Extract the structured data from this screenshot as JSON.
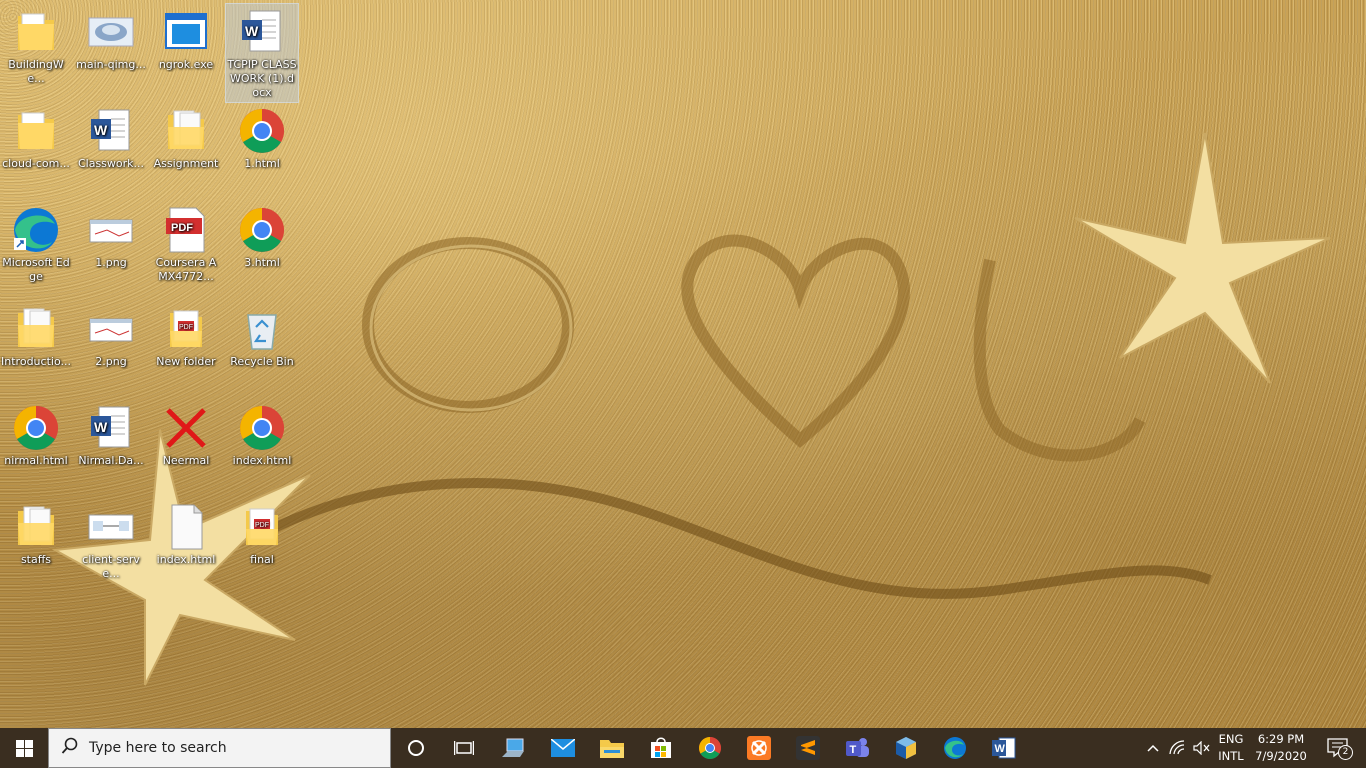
{
  "desktop": {
    "icons": [
      {
        "label": "BuildingWe...",
        "type": "folder"
      },
      {
        "label": "main-qimg...",
        "type": "image"
      },
      {
        "label": "ngrok.exe",
        "type": "exe"
      },
      {
        "label": "TCPIP CLASSWORK (1).docx",
        "type": "word",
        "selected": true
      },
      {
        "label": "cloud-com...",
        "type": "folder"
      },
      {
        "label": "Classwork...",
        "type": "word"
      },
      {
        "label": "Assignment",
        "type": "folder-docs"
      },
      {
        "label": "1.html",
        "type": "chrome"
      },
      {
        "label": "Microsoft Edge",
        "type": "edge"
      },
      {
        "label": "1.png",
        "type": "png"
      },
      {
        "label": "Coursera AMX4772...",
        "type": "pdf"
      },
      {
        "label": "3.html",
        "type": "chrome"
      },
      {
        "label": "Introductio...",
        "type": "folder-docs"
      },
      {
        "label": "2.png",
        "type": "png"
      },
      {
        "label": "New folder",
        "type": "folder-pdf"
      },
      {
        "label": "Recycle Bin",
        "type": "recycle"
      },
      {
        "label": "nirmal.html",
        "type": "chrome"
      },
      {
        "label": "Nirmal.Da...",
        "type": "word"
      },
      {
        "label": "Neermal",
        "type": "broken"
      },
      {
        "label": "index.html",
        "type": "chrome"
      },
      {
        "label": "staffs",
        "type": "folder-docs"
      },
      {
        "label": "client-serve...",
        "type": "diagram"
      },
      {
        "label": "index.html",
        "type": "blank"
      },
      {
        "label": "final",
        "type": "folder-pdf"
      }
    ]
  },
  "taskbar": {
    "start_icon": "windows-logo-icon",
    "search_placeholder": "Type here to search",
    "pinned": [
      {
        "name": "cortana",
        "icon": "cortana-circle-icon"
      },
      {
        "name": "task-view",
        "icon": "task-view-icon"
      },
      {
        "name": "this-pc",
        "icon": "this-pc-icon"
      },
      {
        "name": "mail",
        "icon": "mail-icon"
      },
      {
        "name": "file-explorer",
        "icon": "file-explorer-icon"
      },
      {
        "name": "store",
        "icon": "store-icon"
      },
      {
        "name": "chrome",
        "icon": "chrome-icon"
      },
      {
        "name": "xampp",
        "icon": "xampp-icon"
      },
      {
        "name": "sublime",
        "icon": "sublime-icon"
      },
      {
        "name": "teams",
        "icon": "teams-icon"
      },
      {
        "name": "virtualbox",
        "icon": "virtualbox-icon"
      },
      {
        "name": "edge",
        "icon": "edge-icon"
      },
      {
        "name": "word",
        "icon": "word-icon"
      }
    ],
    "tray": {
      "language_line1": "ENG",
      "language_line2": "INTL",
      "time": "6:29 PM",
      "date": "7/9/2020",
      "notification_count": "2"
    }
  },
  "colors": {
    "taskbar_bg": "#3a2e20",
    "word_blue": "#2b579a",
    "folder_yellow": "#f4c94a",
    "chrome_red": "#db4437",
    "chrome_green": "#0f9d58",
    "chrome_yellow": "#f4b400",
    "chrome_blue": "#4285f4",
    "edge_blue": "#0c78d4",
    "pdf_red": "#d32f2f"
  }
}
